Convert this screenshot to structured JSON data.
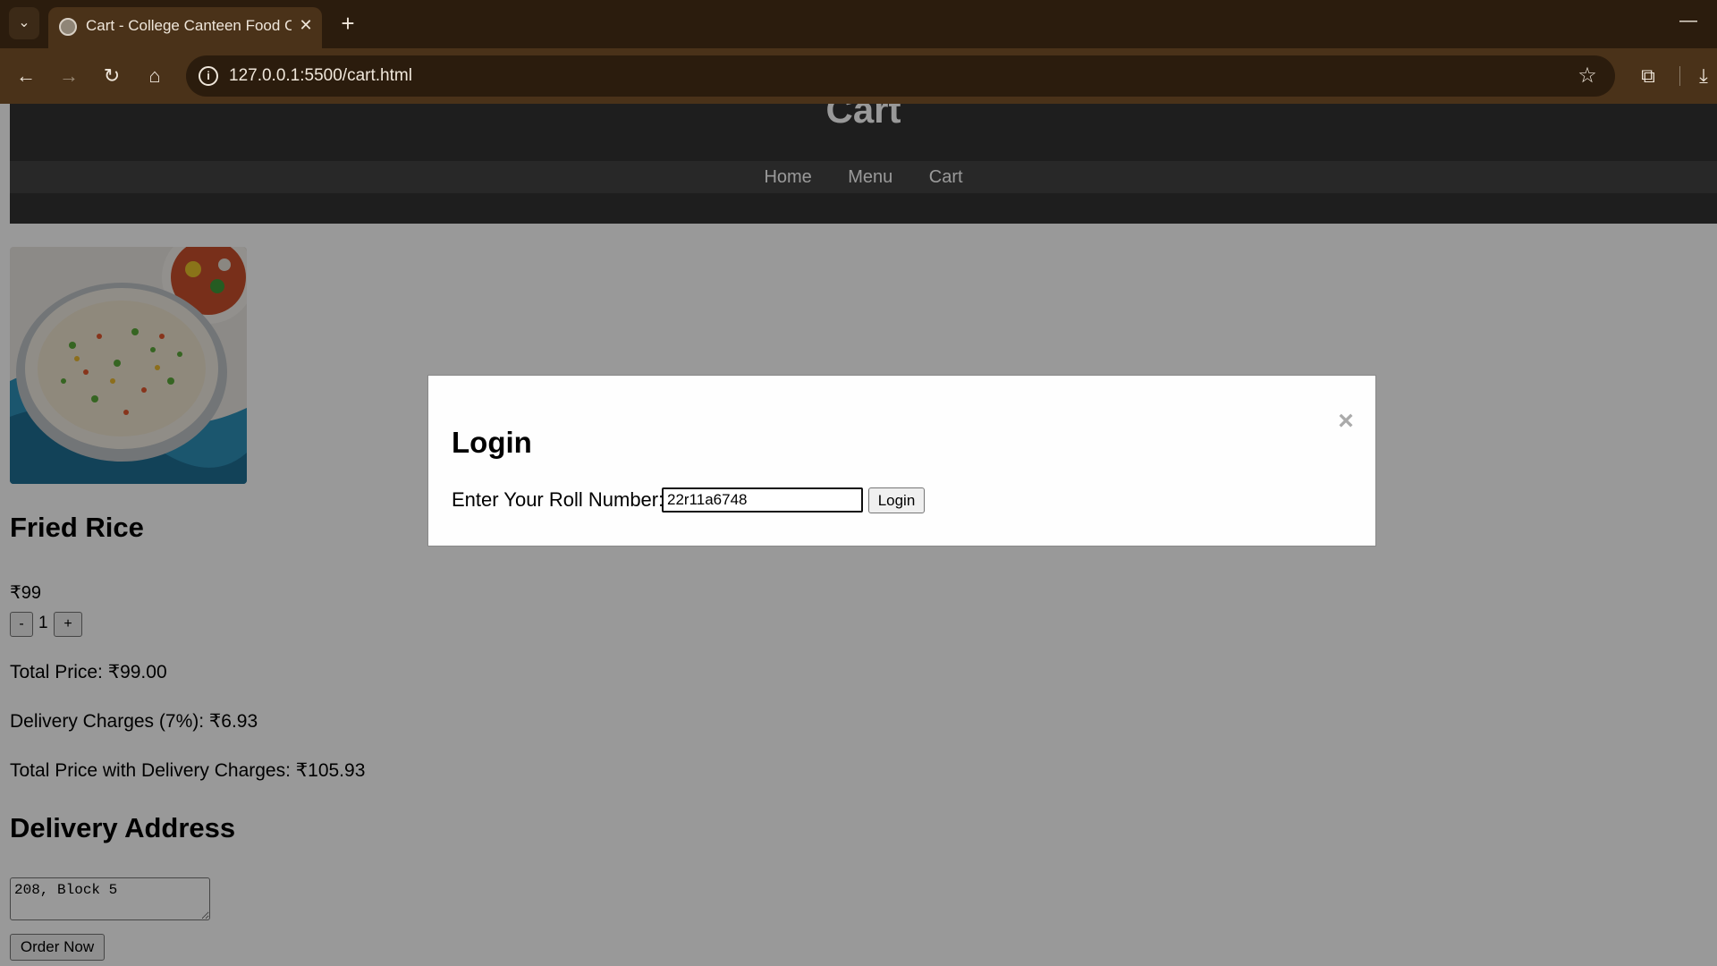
{
  "browser": {
    "tab_title": "Cart - College Canteen Food Or",
    "tab_close": "✕",
    "new_tab": "+",
    "tab_list": "⌄",
    "minimize": "—",
    "url": "127.0.0.1:5500/cart.html",
    "icons": {
      "back": "back-icon",
      "forward": "forward-icon",
      "reload": "reload-icon",
      "home": "home-icon",
      "site_info": "info-icon",
      "bookmark": "star-icon",
      "extensions": "puzzle-icon",
      "downloads": "download-icon"
    }
  },
  "site": {
    "title": "Cart",
    "nav": [
      "Home",
      "Menu",
      "Cart"
    ]
  },
  "cart_item": {
    "name": "Fried Rice",
    "price": "₹99",
    "decrement": "-",
    "quantity": "1",
    "increment": "+"
  },
  "totals": {
    "total_price": "Total Price: ₹99.00",
    "delivery_charges": "Delivery Charges (7%): ₹6.93",
    "total_with_delivery": "Total Price with Delivery Charges: ₹105.93"
  },
  "address": {
    "heading": "Delivery Address",
    "value": "208, Block 5",
    "order_button": "Order Now"
  },
  "login_modal": {
    "title": "Login",
    "close": "×",
    "label": "Enter Your Roll Number:",
    "roll_value": "22r11a6748",
    "button": "Login"
  },
  "colors": {
    "browser_frame": "#2b1c0d",
    "browser_toolbar": "#4a3219",
    "site_header": "#333333",
    "overlay": "rgba(0,0,0,0.4)"
  }
}
